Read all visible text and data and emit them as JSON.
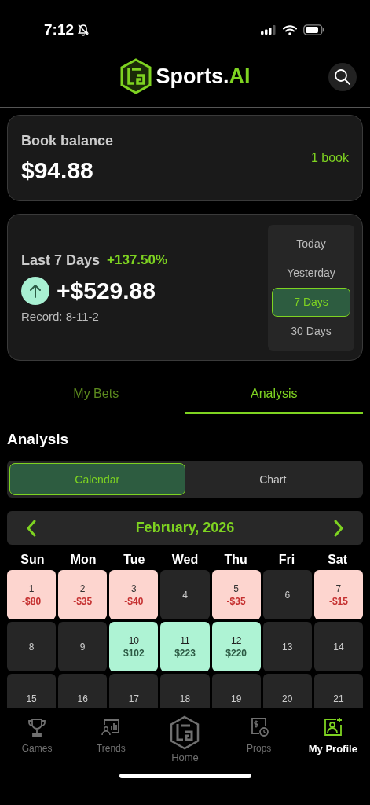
{
  "status_bar": {
    "time": "7:12"
  },
  "header": {
    "brand": "Sports.",
    "brand_accent": "AI"
  },
  "balance_card": {
    "label": "Book balance",
    "amount": "$94.88",
    "books": "1 book"
  },
  "summary_card": {
    "period_label": "Last 7 Days",
    "change": "+137.50%",
    "amount": "+$529.88",
    "record": "Record: 8-11-2",
    "periods": [
      {
        "label": "Today",
        "selected": false
      },
      {
        "label": "Yesterday",
        "selected": false
      },
      {
        "label": "7 Days",
        "selected": true
      },
      {
        "label": "30 Days",
        "selected": false
      }
    ]
  },
  "tabs": [
    {
      "label": "My Bets",
      "selected": false
    },
    {
      "label": "Analysis",
      "selected": true
    }
  ],
  "section_title": "Analysis",
  "view_toggle": [
    {
      "label": "Calendar",
      "selected": true
    },
    {
      "label": "Chart",
      "selected": false
    }
  ],
  "calendar": {
    "month": "February, 2026",
    "weekdays": [
      "Sun",
      "Mon",
      "Tue",
      "Wed",
      "Thu",
      "Fri",
      "Sat"
    ],
    "days": [
      {
        "day": "1",
        "kind": "loss",
        "amount": "-$80"
      },
      {
        "day": "2",
        "kind": "loss",
        "amount": "-$35"
      },
      {
        "day": "3",
        "kind": "loss",
        "amount": "-$40"
      },
      {
        "day": "4",
        "kind": "none"
      },
      {
        "day": "5",
        "kind": "loss",
        "amount": "-$35"
      },
      {
        "day": "6",
        "kind": "none"
      },
      {
        "day": "7",
        "kind": "loss",
        "amount": "-$15"
      },
      {
        "day": "8",
        "kind": "none"
      },
      {
        "day": "9",
        "kind": "none"
      },
      {
        "day": "10",
        "kind": "win",
        "amount": "$102"
      },
      {
        "day": "11",
        "kind": "win",
        "amount": "$223"
      },
      {
        "day": "12",
        "kind": "win",
        "amount": "$220"
      },
      {
        "day": "13",
        "kind": "none"
      },
      {
        "day": "14",
        "kind": "none"
      },
      {
        "day": "15",
        "kind": "none"
      },
      {
        "day": "16",
        "kind": "none"
      },
      {
        "day": "17",
        "kind": "none"
      },
      {
        "day": "18",
        "kind": "none"
      },
      {
        "day": "19",
        "kind": "none"
      },
      {
        "day": "20",
        "kind": "none"
      },
      {
        "day": "21",
        "kind": "none"
      }
    ]
  },
  "tab_bar": [
    {
      "label": "Games",
      "kind": "trophy",
      "selected": false
    },
    {
      "label": "Trends",
      "kind": "trends",
      "selected": false
    },
    {
      "label": "Home",
      "kind": "home",
      "selected": false
    },
    {
      "label": "Props",
      "kind": "props",
      "selected": false
    },
    {
      "label": "My Profile",
      "kind": "profile",
      "selected": true
    }
  ]
}
